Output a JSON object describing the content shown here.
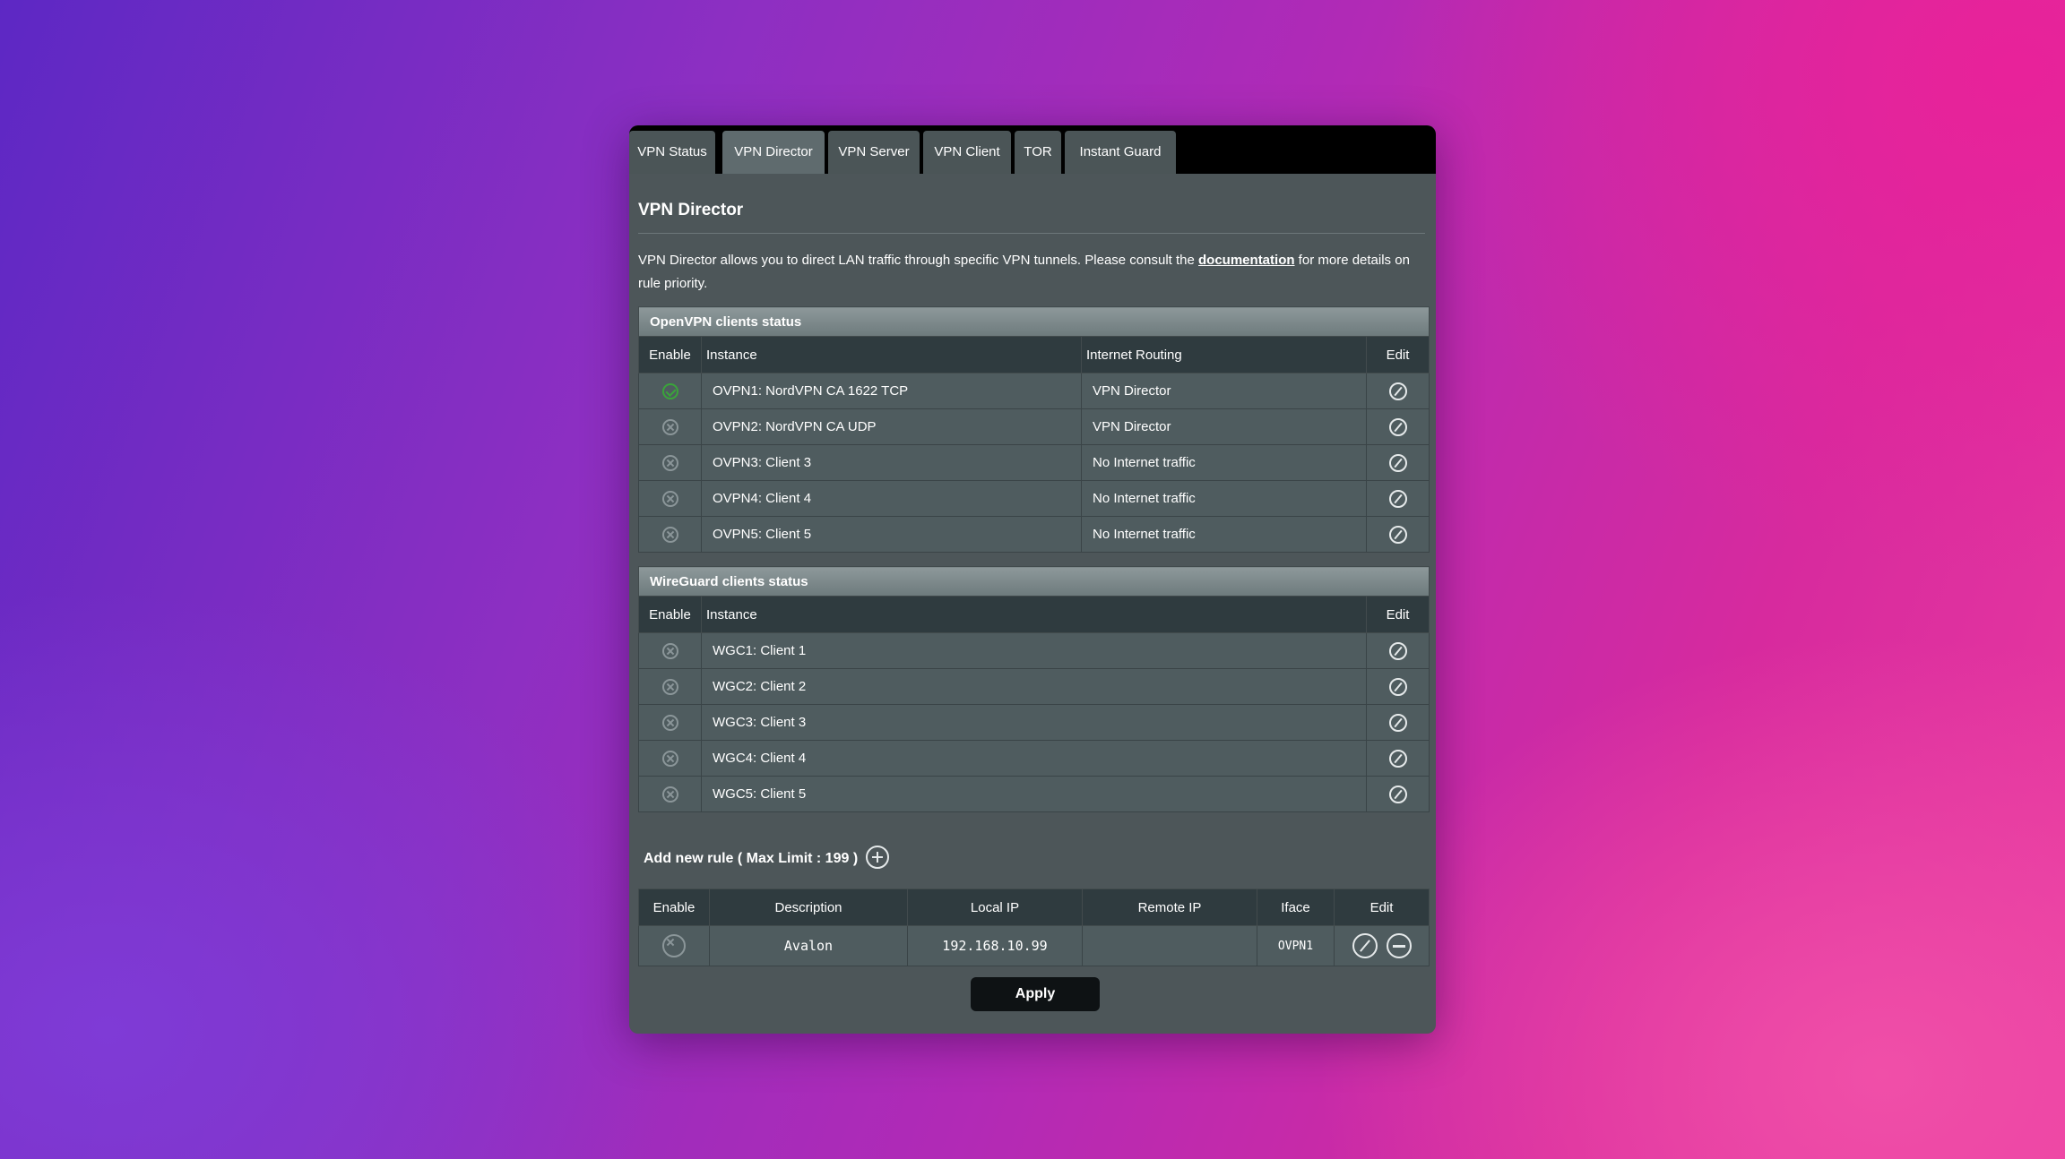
{
  "tabs": [
    {
      "label": "VPN Status"
    },
    {
      "label": "VPN Director"
    },
    {
      "label": "VPN Server"
    },
    {
      "label": "VPN Client"
    },
    {
      "label": "TOR"
    },
    {
      "label": "Instant Guard"
    }
  ],
  "active_tab": "VPN Director",
  "page_title": "VPN Director",
  "description": {
    "before_link": "VPN Director allows you to direct LAN traffic through specific VPN tunnels. Please consult the ",
    "link_text": "documentation",
    "after_link": " for more details on rule priority."
  },
  "openvpn": {
    "title": "OpenVPN clients status",
    "headers": {
      "enable": "Enable",
      "instance": "Instance",
      "routing": "Internet Routing",
      "edit": "Edit"
    },
    "rows": [
      {
        "enabled": true,
        "instance": "OVPN1: NordVPN CA 1622 TCP",
        "routing": "VPN Director"
      },
      {
        "enabled": false,
        "instance": "OVPN2: NordVPN CA UDP",
        "routing": "VPN Director"
      },
      {
        "enabled": false,
        "instance": "OVPN3: Client 3",
        "routing": "No Internet traffic"
      },
      {
        "enabled": false,
        "instance": "OVPN4: Client 4",
        "routing": "No Internet traffic"
      },
      {
        "enabled": false,
        "instance": "OVPN5: Client 5",
        "routing": "No Internet traffic"
      }
    ]
  },
  "wireguard": {
    "title": "WireGuard clients status",
    "headers": {
      "enable": "Enable",
      "instance": "Instance",
      "edit": "Edit"
    },
    "rows": [
      {
        "enabled": false,
        "instance": "WGC1: Client 1"
      },
      {
        "enabled": false,
        "instance": "WGC2: Client 2"
      },
      {
        "enabled": false,
        "instance": "WGC3: Client 3"
      },
      {
        "enabled": false,
        "instance": "WGC4: Client 4"
      },
      {
        "enabled": false,
        "instance": "WGC5: Client 5"
      }
    ]
  },
  "add_rule_label": "Add new rule ( Max Limit : 199 )",
  "rules": {
    "headers": {
      "enable": "Enable",
      "description": "Description",
      "local_ip": "Local IP",
      "remote_ip": "Remote IP",
      "iface": "Iface",
      "edit": "Edit"
    },
    "rows": [
      {
        "enabled": false,
        "description": "Avalon",
        "local_ip": "192.168.10.99",
        "remote_ip": "",
        "iface": "OVPN1"
      }
    ]
  },
  "apply_label": "Apply",
  "colors": {
    "routing_vpn_director": "#ffcc00",
    "enabled_status": "#3aa43a",
    "panel_bg": "#4d5659"
  }
}
